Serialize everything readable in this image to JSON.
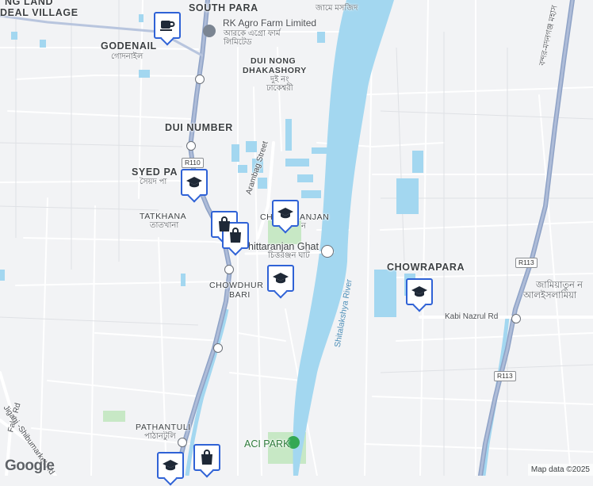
{
  "map": {
    "areas": [
      {
        "id": "top-left",
        "name": "NG LAND"
      },
      {
        "id": "deal-village",
        "name": "DEAL VILLAGE"
      },
      {
        "id": "south-para",
        "name": "SOUTH PARA"
      },
      {
        "id": "godenail",
        "name": "GODENAIL",
        "local": "গোদনাইল"
      },
      {
        "id": "dui-nong",
        "name": "DUI NONG",
        "name2": "DHAKASHORY",
        "local": "দুই নং",
        "local2": "ঢাকেশ্বরী"
      },
      {
        "id": "dui-number",
        "name": "DUI NUMBER"
      },
      {
        "id": "syed-para",
        "name": "SYED PA",
        "local": "সৈয়দ পা"
      },
      {
        "id": "tatkhana",
        "name": "TATKHANA",
        "local": "তাতখানা"
      },
      {
        "id": "chittaranjan",
        "name": "CH",
        "name2": "ANJAN",
        "local": "ন"
      },
      {
        "id": "chowdhury-bari",
        "name": "CHOWDHUR",
        "name2": "BARI"
      },
      {
        "id": "chowrapara",
        "name": "CHOWRAPARA"
      },
      {
        "id": "pathantuli",
        "name": "PATHANTULI",
        "local": "পাঠানটুলি"
      }
    ],
    "pois": [
      {
        "id": "rk-agro",
        "name": "RK Agro Farm Limited",
        "local": "আরকে এগ্রো ফার্ম",
        "local2": "লিমিটেড"
      },
      {
        "id": "chittaranjan-ghat",
        "name": "hittaranjan Ghat",
        "local": "চিত্তরঞ্জন ঘাট"
      },
      {
        "id": "aci-park",
        "name": "ACI PARK"
      },
      {
        "id": "jamiatun",
        "name": "জামিয়াতুন ন",
        "name2": "আলইসলামিয়া"
      },
      {
        "id": "mosque",
        "name": "জামে মসজিদ"
      }
    ],
    "roads": [
      {
        "id": "arambag",
        "name": "Arambag Street"
      },
      {
        "id": "kabi-nazrul",
        "name": "Kabi Nazrul Rd"
      },
      {
        "id": "fakir",
        "name": "Fakir Rd"
      },
      {
        "id": "shibumarket",
        "name": "Jiganj -Shibumarket Rd"
      },
      {
        "id": "right-edge",
        "name": "বন্দর-মদনগঞ্জ মহাস"
      }
    ],
    "river": {
      "name": "Shitalakshya River"
    },
    "shields": [
      {
        "id": "r110",
        "label": "R110"
      },
      {
        "id": "r113-a",
        "label": "R113"
      },
      {
        "id": "r113-b",
        "label": "R113"
      }
    ],
    "markers": [
      {
        "id": "cafe",
        "icon": "coffee-cup-icon"
      },
      {
        "id": "school-syed",
        "icon": "graduation-cap-icon"
      },
      {
        "id": "school-chittaranjan",
        "icon": "graduation-cap-icon"
      },
      {
        "id": "shop-tatkhana-back",
        "icon": "shopping-bag-icon"
      },
      {
        "id": "shop-tatkhana",
        "icon": "shopping-bag-icon"
      },
      {
        "id": "school-chowdhury",
        "icon": "graduation-cap-icon"
      },
      {
        "id": "school-chowrapara",
        "icon": "graduation-cap-icon"
      },
      {
        "id": "school-bottom",
        "icon": "graduation-cap-icon"
      },
      {
        "id": "shop-bottom",
        "icon": "shopping-bag-icon"
      }
    ],
    "colors": {
      "background": "#f2f3f5",
      "water": "#a3d7f0",
      "road": "#8ea2c6",
      "marker_border": "#2f62d6",
      "park": "#c7e8c5"
    }
  },
  "footer": {
    "logo": "Google",
    "attribution": "Map data ©2025"
  }
}
